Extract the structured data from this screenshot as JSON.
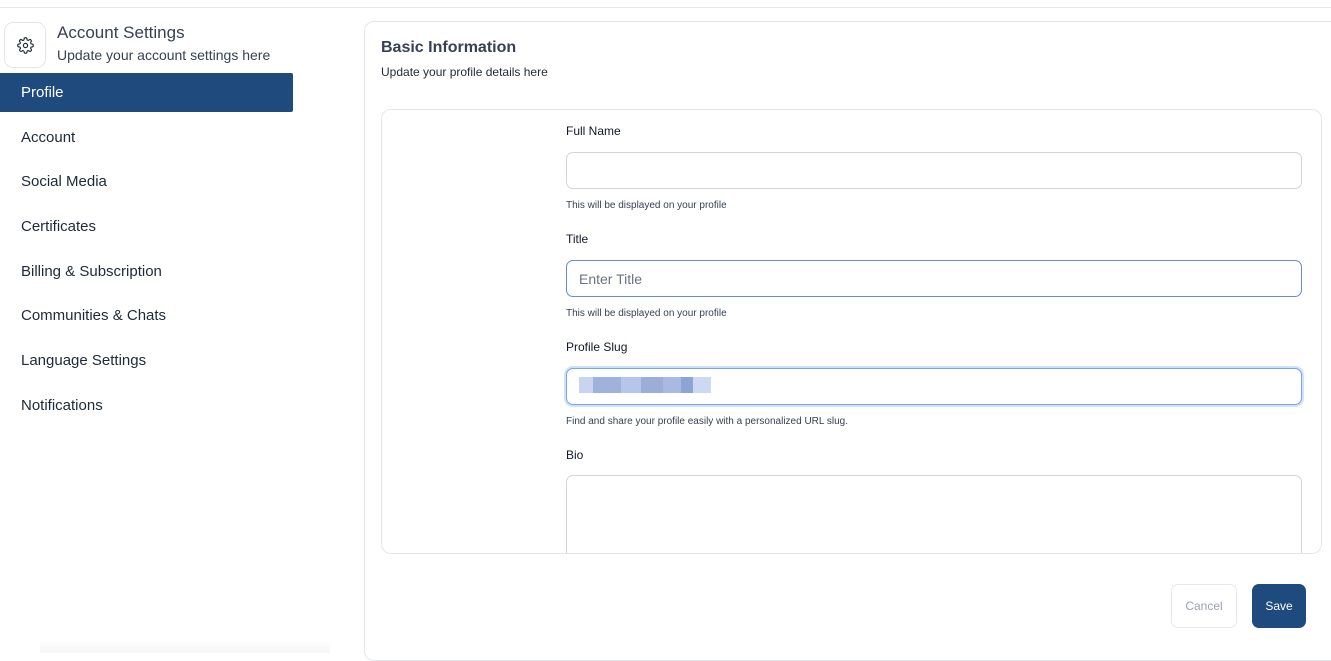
{
  "sidebar": {
    "title": "Account Settings",
    "subtitle": "Update your account settings here",
    "icon": "gear-icon",
    "items": [
      {
        "label": "Profile",
        "active": true
      },
      {
        "label": "Account",
        "active": false
      },
      {
        "label": "Social Media",
        "active": false
      },
      {
        "label": "Certificates",
        "active": false
      },
      {
        "label": "Billing & Subscription",
        "active": false
      },
      {
        "label": "Communities & Chats",
        "active": false
      },
      {
        "label": "Language Settings",
        "active": false
      },
      {
        "label": "Notifications",
        "active": false
      }
    ]
  },
  "main": {
    "title": "Basic Information",
    "subtitle": "Update your profile details here",
    "fields": {
      "full_name": {
        "label": "Full Name",
        "value": "",
        "placeholder": "",
        "help": "This will be displayed on your profile"
      },
      "title": {
        "label": "Title",
        "value": "",
        "placeholder": "Enter Title",
        "help": "This will be displayed on your profile"
      },
      "profile_slug": {
        "label": "Profile Slug",
        "value": "",
        "help": "Find and share your profile easily with a personalized URL slug."
      },
      "bio": {
        "label": "Bio",
        "value": ""
      }
    },
    "actions": {
      "cancel_label": "Cancel",
      "save_label": "Save"
    }
  },
  "colors": {
    "accent": "#1e4a7e",
    "focus_border": "#6b87e6",
    "border": "#e5e7eb"
  }
}
